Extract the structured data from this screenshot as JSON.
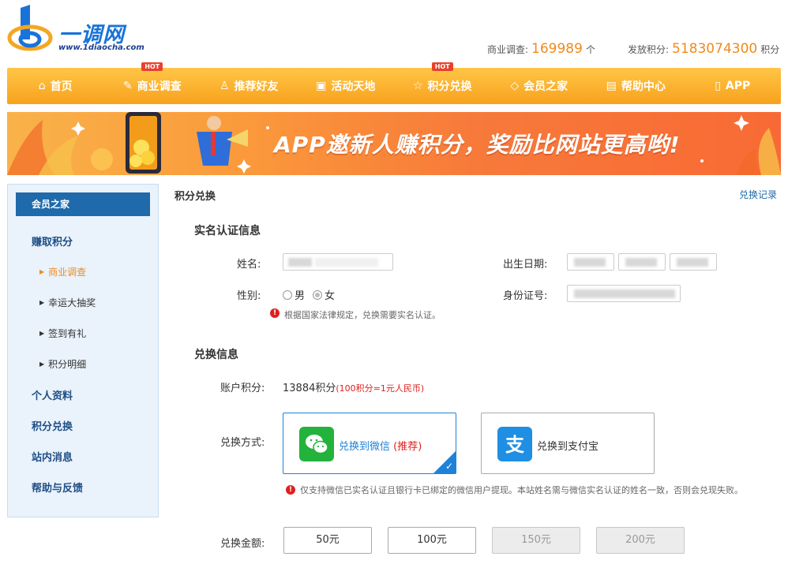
{
  "logo": {
    "text": "一调网",
    "url": "www.1diaocha.com"
  },
  "stats": {
    "survey_label": "商业调查:",
    "survey_count": "169989",
    "survey_unit": "个",
    "points_label": "发放积分:",
    "points_count": "5183074300",
    "points_unit": "积分"
  },
  "nav": {
    "items": [
      {
        "label": "首页",
        "icon": "home-icon"
      },
      {
        "label": "商业调查",
        "icon": "edit-icon",
        "badge": "HOT"
      },
      {
        "label": "推荐好友",
        "icon": "user-icon"
      },
      {
        "label": "活动天地",
        "icon": "gift-icon"
      },
      {
        "label": "积分兑换",
        "icon": "star-icon",
        "badge": "HOT"
      },
      {
        "label": "会员之家",
        "icon": "diamond-icon"
      },
      {
        "label": "帮助中心",
        "icon": "book-icon"
      },
      {
        "label": "APP",
        "icon": "phone-icon"
      }
    ]
  },
  "banner": {
    "text": "APP邀新人赚积分，奖励比网站更高哟!"
  },
  "sidebar": {
    "title": "会员之家",
    "earn": "赚取积分",
    "subs": [
      "商业调查",
      "幸运大抽奖",
      "签到有礼",
      "积分明细"
    ],
    "profile": "个人资料",
    "exchange": "积分兑换",
    "messages": "站内消息",
    "help": "帮助与反馈"
  },
  "main": {
    "crumb": "积分兑换",
    "record_link": "兑换记录",
    "identity_title": "实名认证信息",
    "name_label": "姓名:",
    "birth_label": "出生日期:",
    "gender_label": "性别:",
    "gender_male": "男",
    "gender_female": "女",
    "id_label": "身份证号:",
    "legal_notice": "根据国家法律规定，兑换需要实名认证。",
    "exchange_title": "兑换信息",
    "account_points_label": "账户积分:",
    "account_points_value": "13884积分",
    "rate_text": "(100积分=1元人民币)",
    "method_label": "兑换方式:",
    "wechat_text": "兑换到微信",
    "wechat_recommend": "(推荐)",
    "alipay_text": "兑换到支付宝",
    "wechat_notice": "仅支持微信已实名认证且银行卡已绑定的微信用户提现。本站姓名需与微信实名认证的姓名一致，否则会兑现失败。",
    "amount_label": "兑换金额:",
    "amounts": [
      "50元",
      "100元",
      "150元",
      "200元"
    ]
  },
  "colors": {
    "brand": "#1e6aab",
    "accent": "#f08a1c",
    "nav": "#f8a21c",
    "wechat": "#23b33c",
    "alipay": "#1f8fe3"
  }
}
